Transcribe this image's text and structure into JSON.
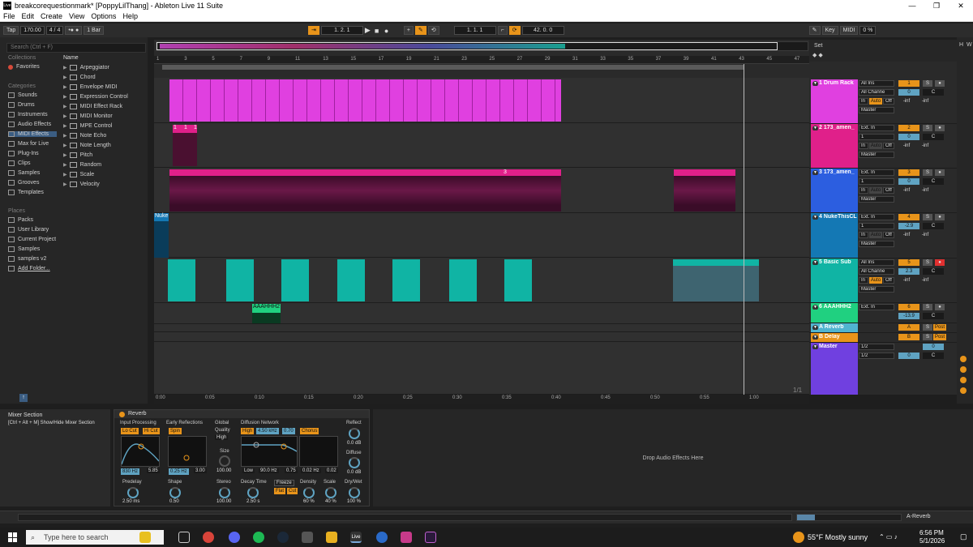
{
  "window": {
    "title": "breakcorequestionmark* [PoppyLilThang] - Ableton Live 11 Suite",
    "minimize": "—",
    "maximize": "❐",
    "close": "✕",
    "logo": "Live"
  },
  "menu": [
    "File",
    "Edit",
    "Create",
    "View",
    "Options",
    "Help"
  ],
  "transport": {
    "tap": "Tap",
    "tempo": "170.00",
    "meter": "4 / 4",
    "metro": "•● ●",
    "quant": "1 Bar",
    "position": "1.  2.  1",
    "loop_start": "1.  1.  1",
    "loop_len": "42.  0.  0",
    "key": "Key",
    "midi": "MIDI",
    "cpu": "0 %"
  },
  "browser": {
    "search_placeholder": "Search (Ctrl + F)",
    "collections_header": "Collections",
    "favorites": "Favorites",
    "categories_header": "Categories",
    "categories": [
      "Sounds",
      "Drums",
      "Instruments",
      "Audio Effects",
      "MIDI Effects",
      "Max for Live",
      "Plug-Ins",
      "Clips",
      "Samples",
      "Grooves",
      "Templates"
    ],
    "places_header": "Places",
    "places": [
      "Packs",
      "User Library",
      "Current Project",
      "Samples",
      "samples v2",
      "Add Folder..."
    ],
    "name_header": "Name",
    "items": [
      "Arpeggiator",
      "Chord",
      "Envelope MIDI",
      "Expression Control",
      "MIDI Effect Rack",
      "MIDI Monitor",
      "MPE Control",
      "Note Echo",
      "Note Length",
      "Pitch",
      "Random",
      "Scale",
      "Velocity"
    ]
  },
  "ruler": [
    "1",
    "3",
    "5",
    "7",
    "9",
    "11",
    "13",
    "15",
    "17",
    "19",
    "21",
    "23",
    "25",
    "27",
    "29",
    "31",
    "33",
    "35",
    "37",
    "39",
    "41",
    "43",
    "45",
    "47"
  ],
  "time_axis": [
    "0:00",
    "0:05",
    "0:10",
    "0:15",
    "0:20",
    "0:25",
    "0:30",
    "0:35",
    "0:40",
    "0:45",
    "0:50",
    "0:55",
    "1:00"
  ],
  "clip_labels": {
    "nuke": "Nuke",
    "aaahhh": "AAAHHH2",
    "small1": "1",
    "small2": "1",
    "small3": "1",
    "marker": "3"
  },
  "page_indicator": "1/1",
  "set_label": "Set",
  "tracks": [
    {
      "name": "1 Drum Rack",
      "color": "#e040e0",
      "input": "All Ins",
      "channel": "All Channe",
      "in": "In",
      "auto": "Auto",
      "off": "Off",
      "output": "Master",
      "num": "1",
      "s": "S",
      "vol": "0",
      "pan": "C",
      "l": "-inf",
      "r": "-inf"
    },
    {
      "name": "2 173_amen_",
      "color": "#e0208a",
      "input": "Ext. In",
      "channel": "1",
      "in": "In",
      "auto": "Auto",
      "off": "Off",
      "output": "Master",
      "num": "2",
      "s": "S",
      "vol": "0",
      "pan": "C",
      "l": "-inf",
      "r": "-inf"
    },
    {
      "name": "3 173_amen_",
      "color": "#2c5ee0",
      "input": "Ext. In",
      "channel": "1",
      "in": "In",
      "auto": "Auto",
      "off": "Off",
      "output": "Master",
      "num": "3",
      "s": "S",
      "vol": "0",
      "pan": "C",
      "l": "-inf",
      "r": "-inf"
    },
    {
      "name": "4 NukeThisCL",
      "color": "#1478b4",
      "input": "Ext. In",
      "channel": "1",
      "in": "In",
      "auto": "Auto",
      "off": "Off",
      "output": "Master",
      "num": "4",
      "s": "S",
      "vol": "-2.9",
      "pan": "C",
      "l": "-inf",
      "r": "-inf"
    },
    {
      "name": "5 Basic Sub",
      "color": "#10b4a4",
      "input": "All Ins",
      "channel": "All Channe",
      "in": "In",
      "auto": "Auto",
      "off": "Off",
      "output": "Master",
      "num": "5",
      "s": "S",
      "vol": "2.3",
      "pan": "C",
      "l": "-inf",
      "r": "-inf"
    },
    {
      "name": "6 AAAHHH2",
      "color": "#20d080",
      "input": "Ext. In",
      "num": "6",
      "s": "S",
      "vol": "-13.9",
      "pan": "C"
    },
    {
      "name": "A Reverb",
      "color": "#50b4d0",
      "num": "A",
      "s": "S",
      "post": "Post"
    },
    {
      "name": "B Delay",
      "color": "#e8941a",
      "num": "B",
      "s": "S",
      "post": "Post"
    },
    {
      "name": "Master",
      "color": "#7040e0",
      "output": "1/2",
      "output2": "1/2",
      "vol": "0",
      "vol2": "0",
      "pan": "C"
    }
  ],
  "mixer_section": {
    "title": "Mixer Section",
    "hint": "[Ctrl + Alt + M] Show/Hide Mixer Section"
  },
  "reverb": {
    "title": "Reverb",
    "input_processing": "Input Processing",
    "lo_cut": "Lo Cut",
    "hi_cut": "Hi Cut",
    "freq": "830 Hz",
    "q": "5.85",
    "early": "Early Reflections",
    "spin": "Spin",
    "er_a": "0.25 Hz",
    "er_b": "3.00",
    "global": "Global",
    "quality": "Quality",
    "quality_val": "High",
    "size": "Size",
    "size_val": "100.00",
    "diffusion": "Diffusion Network",
    "high": "High",
    "high_freq": "4.50 kHz",
    "high_val": "0.70",
    "chorus": "Chorus",
    "low": "Low",
    "low_freq": "90.0 Hz",
    "low_val": "0.75",
    "chorus_a": "0.02 Hz",
    "chorus_b": "0.02",
    "reflect": "Reflect",
    "reflect_val": "0.0 dB",
    "diffuse": "Diffuse",
    "diffuse_val": "0.0 dB",
    "predelay": "Predelay",
    "predelay_val": "2.50 ms",
    "shape": "Shape",
    "shape_val": "0.50",
    "stereo": "Stereo",
    "stereo_val": "100.00",
    "decay": "Decay Time",
    "decay_val": "2.50 s",
    "freeze": "Freeze",
    "flat": "Flat",
    "cut": "Cut",
    "density": "Density",
    "density_val": "60 %",
    "scale": "Scale",
    "scale_val": "40 %",
    "drywet": "Dry/Wet",
    "drywet_val": "100 %"
  },
  "drop_zone": "Drop Audio Effects Here",
  "status": {
    "right": "A-Reverb"
  },
  "taskbar": {
    "search": "Type here to search",
    "weather": "55°F  Mostly sunny",
    "time": "6:56 PM",
    "date": "5/1/2026"
  }
}
